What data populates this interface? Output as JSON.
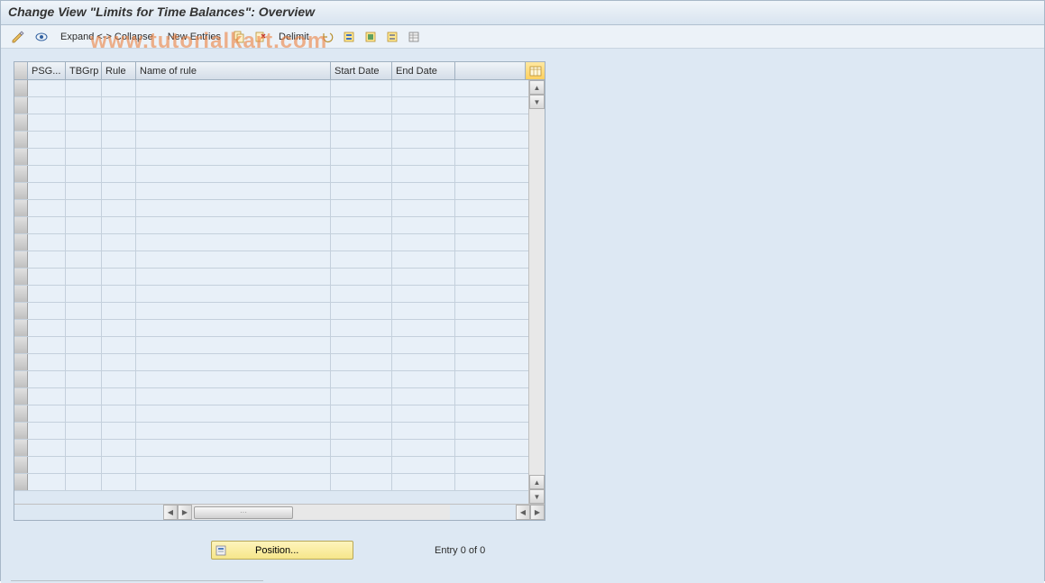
{
  "title": "Change View \"Limits for Time Balances\": Overview",
  "toolbar": {
    "expand_collapse": "Expand <-> Collapse",
    "new_entries": "New Entries",
    "delimit": "Delimit"
  },
  "table": {
    "columns": {
      "psg": "PSG...",
      "tbgrp": "TBGrp",
      "rule": "Rule",
      "name": "Name of rule",
      "start": "Start Date",
      "end": "End Date"
    },
    "rows": [
      {
        "psg": "",
        "tbgrp": "",
        "rule": "",
        "name": "",
        "start": "",
        "end": ""
      },
      {
        "psg": "",
        "tbgrp": "",
        "rule": "",
        "name": "",
        "start": "",
        "end": ""
      },
      {
        "psg": "",
        "tbgrp": "",
        "rule": "",
        "name": "",
        "start": "",
        "end": ""
      },
      {
        "psg": "",
        "tbgrp": "",
        "rule": "",
        "name": "",
        "start": "",
        "end": ""
      },
      {
        "psg": "",
        "tbgrp": "",
        "rule": "",
        "name": "",
        "start": "",
        "end": ""
      },
      {
        "psg": "",
        "tbgrp": "",
        "rule": "",
        "name": "",
        "start": "",
        "end": ""
      },
      {
        "psg": "",
        "tbgrp": "",
        "rule": "",
        "name": "",
        "start": "",
        "end": ""
      },
      {
        "psg": "",
        "tbgrp": "",
        "rule": "",
        "name": "",
        "start": "",
        "end": ""
      },
      {
        "psg": "",
        "tbgrp": "",
        "rule": "",
        "name": "",
        "start": "",
        "end": ""
      },
      {
        "psg": "",
        "tbgrp": "",
        "rule": "",
        "name": "",
        "start": "",
        "end": ""
      },
      {
        "psg": "",
        "tbgrp": "",
        "rule": "",
        "name": "",
        "start": "",
        "end": ""
      },
      {
        "psg": "",
        "tbgrp": "",
        "rule": "",
        "name": "",
        "start": "",
        "end": ""
      },
      {
        "psg": "",
        "tbgrp": "",
        "rule": "",
        "name": "",
        "start": "",
        "end": ""
      },
      {
        "psg": "",
        "tbgrp": "",
        "rule": "",
        "name": "",
        "start": "",
        "end": ""
      },
      {
        "psg": "",
        "tbgrp": "",
        "rule": "",
        "name": "",
        "start": "",
        "end": ""
      },
      {
        "psg": "",
        "tbgrp": "",
        "rule": "",
        "name": "",
        "start": "",
        "end": ""
      },
      {
        "psg": "",
        "tbgrp": "",
        "rule": "",
        "name": "",
        "start": "",
        "end": ""
      },
      {
        "psg": "",
        "tbgrp": "",
        "rule": "",
        "name": "",
        "start": "",
        "end": ""
      },
      {
        "psg": "",
        "tbgrp": "",
        "rule": "",
        "name": "",
        "start": "",
        "end": ""
      },
      {
        "psg": "",
        "tbgrp": "",
        "rule": "",
        "name": "",
        "start": "",
        "end": ""
      },
      {
        "psg": "",
        "tbgrp": "",
        "rule": "",
        "name": "",
        "start": "",
        "end": ""
      },
      {
        "psg": "",
        "tbgrp": "",
        "rule": "",
        "name": "",
        "start": "",
        "end": ""
      },
      {
        "psg": "",
        "tbgrp": "",
        "rule": "",
        "name": "",
        "start": "",
        "end": ""
      },
      {
        "psg": "",
        "tbgrp": "",
        "rule": "",
        "name": "",
        "start": "",
        "end": ""
      }
    ]
  },
  "footer": {
    "position_label": "Position...",
    "entry_label": "Entry 0 of 0"
  },
  "watermark": "www.tutorialkart.com"
}
